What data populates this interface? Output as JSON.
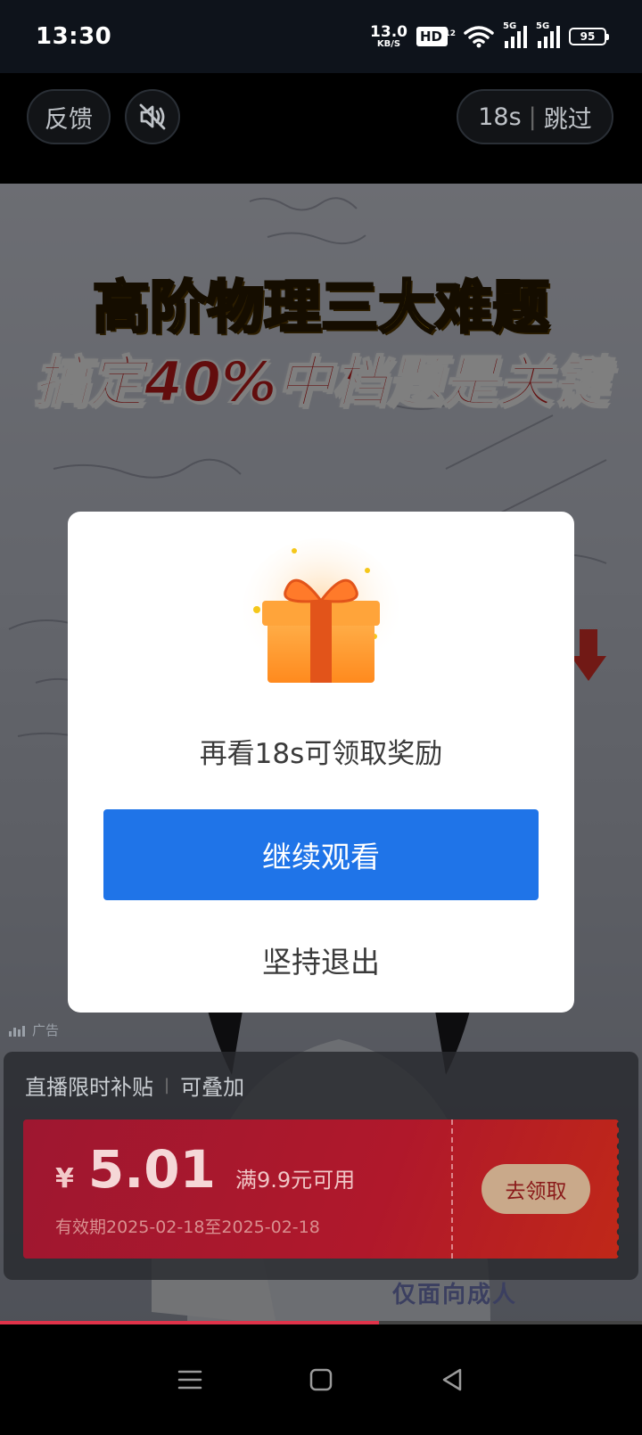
{
  "status_bar": {
    "time": "13:30",
    "net_speed": "13.0",
    "net_unit": "KB/S",
    "hd": "HD",
    "hd_sim": "12",
    "signal_1": "5G",
    "signal_2": "5G",
    "battery": "95"
  },
  "top_controls": {
    "feedback_label": "反馈",
    "mute_icon": "speaker-muted-icon",
    "skip_seconds": "18s",
    "skip_separator": "|",
    "skip_label": "跳过"
  },
  "ad": {
    "headline_1": "高阶物理三大难题",
    "headline_2": "搞定40%中档题是关键",
    "ad_tag": "广告",
    "bottom_caption": "仅面向成人",
    "progress_percent": 59
  },
  "coupon_panel": {
    "title": "直播限时补贴",
    "title_extra": "可叠加",
    "currency": "¥",
    "amount": "5.01",
    "threshold": "满9.9元可用",
    "validity": "有效期2025-02-18至2025-02-18",
    "claim_label": "去领取"
  },
  "modal": {
    "icon": "gift-box-icon",
    "message": "再看18s可领取奖励",
    "continue_label": "继续观看",
    "exit_label": "坚持退出"
  },
  "nav_bar": {
    "icons": [
      "menu-icon",
      "home-icon",
      "back-icon"
    ]
  },
  "colors": {
    "primary_button": "#1f74e8",
    "coupon_red": "#b0182b",
    "headline_yellow": "#f5c20a",
    "headline_red": "#c51a1a"
  }
}
